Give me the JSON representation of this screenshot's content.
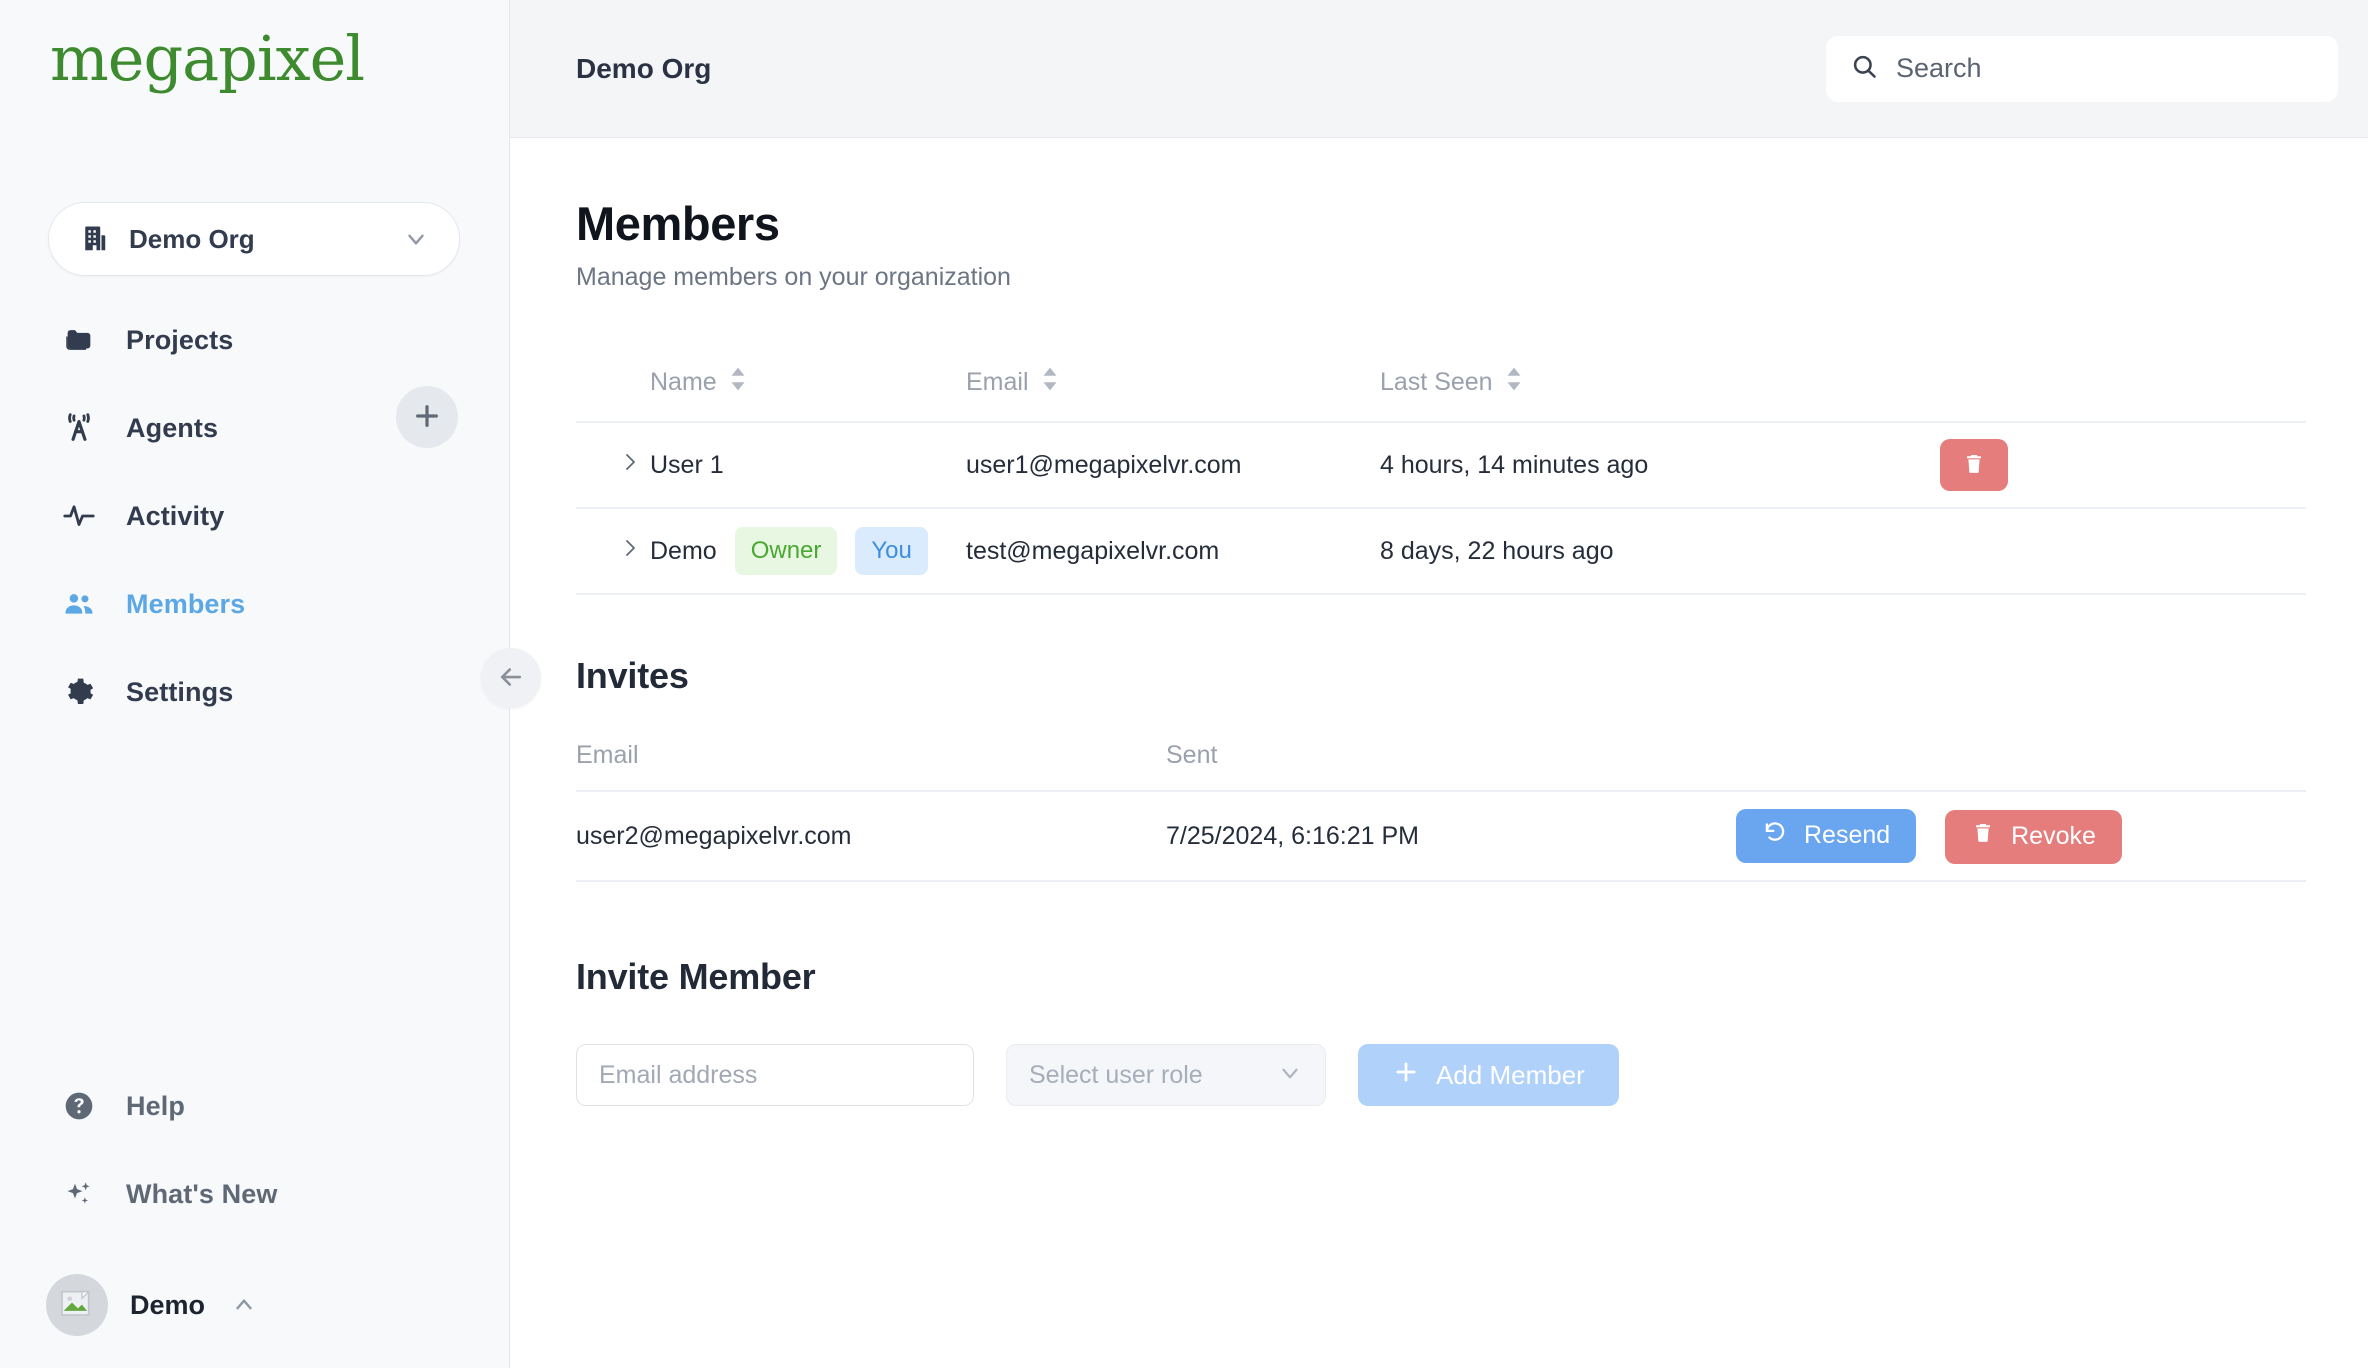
{
  "brand": {
    "logo_text": "megapixel",
    "logo_color": "#3d8b2e"
  },
  "sidebar": {
    "org_switcher": {
      "label": "Demo Org",
      "icon": "building-icon",
      "chevron": "chevron-down-icon"
    },
    "items": [
      {
        "label": "Projects",
        "icon": "folder-icon",
        "active": false
      },
      {
        "label": "Agents",
        "icon": "broadcast-tower-icon",
        "active": false
      },
      {
        "label": "Activity",
        "icon": "pulse-icon",
        "active": false
      },
      {
        "label": "Members",
        "icon": "people-icon",
        "active": true
      },
      {
        "label": "Settings",
        "icon": "gear-icon",
        "active": false
      }
    ],
    "add_agent": {
      "icon": "plus-icon"
    },
    "bottom_items": [
      {
        "label": "Help",
        "icon": "question-circle-icon"
      },
      {
        "label": "What's New",
        "icon": "sparkles-icon"
      }
    ],
    "user": {
      "name": "Demo",
      "avatar": "broken-image-icon",
      "chevron": "chevron-up-icon"
    },
    "collapse": {
      "icon": "arrow-left-icon"
    },
    "active_color": "#5ba8e5"
  },
  "topbar": {
    "title": "Demo Org",
    "search": {
      "placeholder": "Search",
      "value": "",
      "icon": "search-icon"
    }
  },
  "page": {
    "title": "Members",
    "subtitle": "Manage members on your organization"
  },
  "members_table": {
    "columns": [
      {
        "label": "",
        "sortable": false
      },
      {
        "label": "Name",
        "sortable": true
      },
      {
        "label": "Email",
        "sortable": true
      },
      {
        "label": "Last Seen",
        "sortable": true
      },
      {
        "label": "",
        "sortable": false
      }
    ],
    "rows": [
      {
        "name": "User 1",
        "badges": [],
        "email": "user1@megapixelvr.com",
        "last_seen": "4 hours, 14 minutes ago",
        "has_delete": true
      },
      {
        "name": "Demo",
        "badges": [
          {
            "label": "Owner",
            "type": "owner"
          },
          {
            "label": "You",
            "type": "you"
          }
        ],
        "email": "test@megapixelvr.com",
        "last_seen": "8 days, 22 hours ago",
        "has_delete": false
      }
    ]
  },
  "invites": {
    "title": "Invites",
    "columns": [
      {
        "label": "Email"
      },
      {
        "label": "Sent"
      },
      {
        "label": ""
      }
    ],
    "rows": [
      {
        "email": "user2@megapixelvr.com",
        "sent": "7/25/2024, 6:16:21 PM",
        "resend_label": "Resend",
        "revoke_label": "Revoke"
      }
    ]
  },
  "invite_member": {
    "title": "Invite Member",
    "email_placeholder": "Email address",
    "email_value": "",
    "role_placeholder": "Select user role",
    "role_value": "",
    "add_label": "Add Member"
  },
  "colors": {
    "accent_blue": "#5ba8e5",
    "danger": "#e57d7d",
    "resend_blue": "#6aa5f0",
    "add_blue": "#b0d1f9",
    "owner_badge_bg": "#e8f7e2",
    "owner_badge_fg": "#49a832",
    "you_badge_bg": "#d9ebfd",
    "you_badge_fg": "#3d8ee0"
  }
}
